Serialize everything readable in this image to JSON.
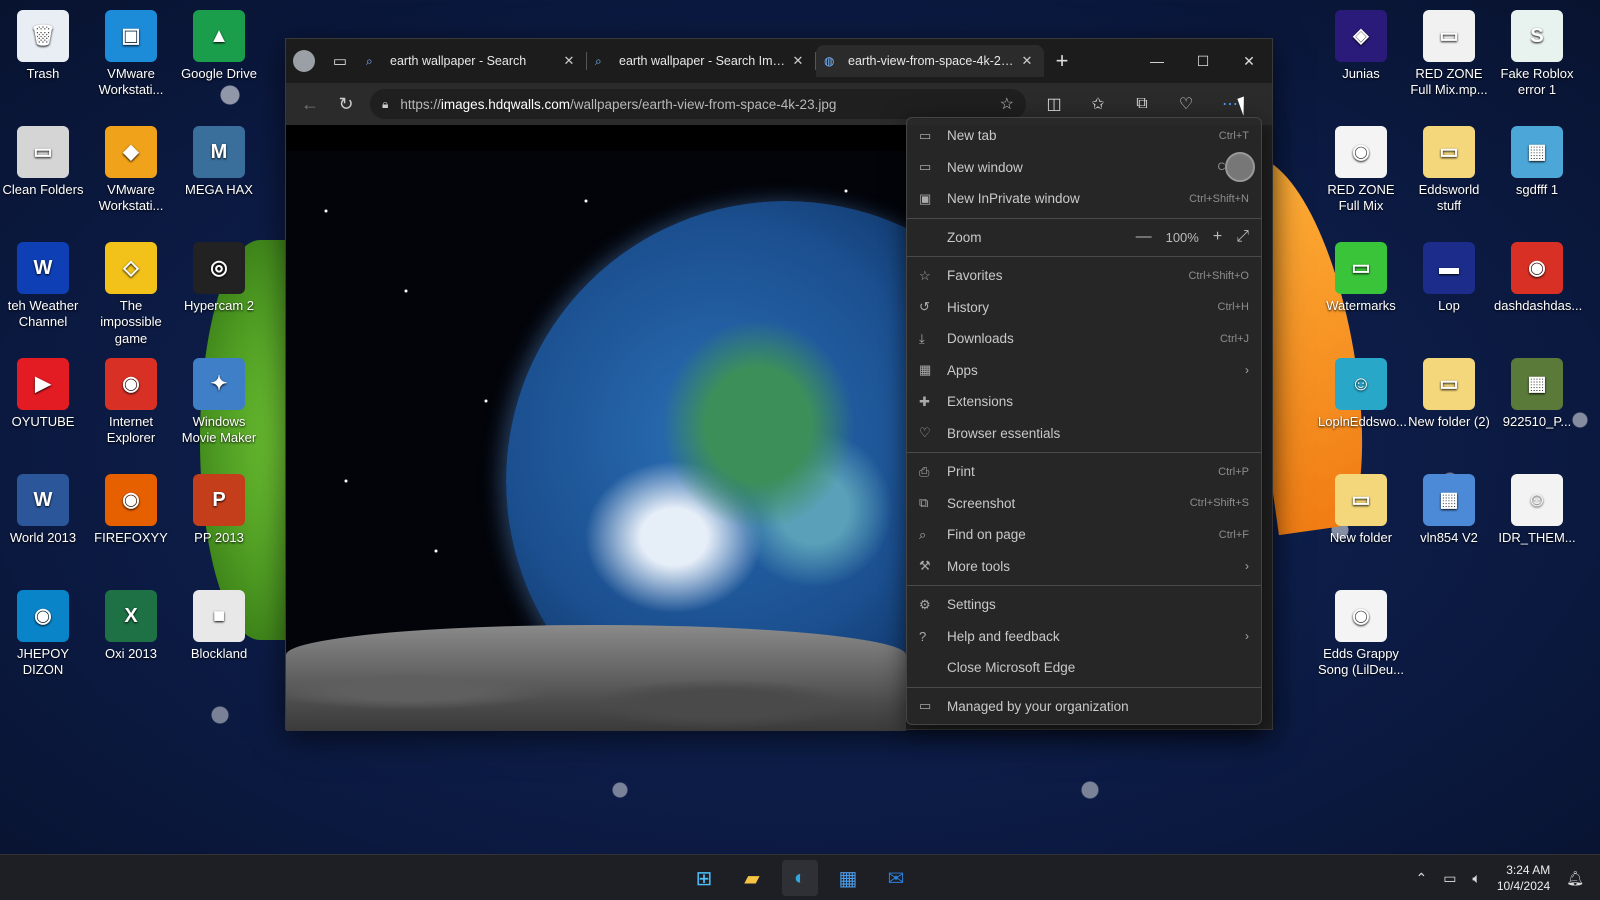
{
  "desktop": {
    "icons_left": [
      {
        "label": "Trash",
        "glyph": "🗑",
        "bg": "#e9eef5"
      },
      {
        "label": "VMware Workstati...",
        "glyph": "▣",
        "bg": "#1c8bd8"
      },
      {
        "label": "Google Drive",
        "glyph": "▲",
        "bg": "#1a9e4c"
      },
      {
        "label": "Clean Folders",
        "glyph": "▭",
        "bg": "#d5d5d5"
      },
      {
        "label": "VMware Workstati...",
        "glyph": "◆",
        "bg": "#f0a21a"
      },
      {
        "label": "MEGA HAX",
        "glyph": "M",
        "bg": "#3a6f9c"
      },
      {
        "label": "teh Weather Channel",
        "glyph": "W",
        "bg": "#0f3fb4"
      },
      {
        "label": "The impossible game",
        "glyph": "◇",
        "bg": "#f2c21a"
      },
      {
        "label": "Hypercam 2",
        "glyph": "◎",
        "bg": "#222"
      },
      {
        "label": "OYUTUBE",
        "glyph": "▶",
        "bg": "#e31b23"
      },
      {
        "label": "Internet Explorer",
        "glyph": "◉",
        "bg": "#d93025"
      },
      {
        "label": "Windows Movie Maker",
        "glyph": "✦",
        "bg": "#3f7fc8"
      },
      {
        "label": "World 2013",
        "glyph": "W",
        "bg": "#2b579a"
      },
      {
        "label": "FIREFOXYY",
        "glyph": "◉",
        "bg": "#e66000"
      },
      {
        "label": "PP 2013",
        "glyph": "P",
        "bg": "#c43e1c"
      },
      {
        "label": "JHEPOY DIZON",
        "glyph": "◉",
        "bg": "#0a84c8"
      },
      {
        "label": "Oxi 2013",
        "glyph": "X",
        "bg": "#1e7145"
      },
      {
        "label": "Blockland",
        "glyph": "■",
        "bg": "#e8e8e8"
      }
    ],
    "icons_right": [
      {
        "label": "Junias",
        "glyph": "◈",
        "bg": "#2a1b7a"
      },
      {
        "label": "RED ZONE Full Mix.mp...",
        "glyph": "▭",
        "bg": "#f1f1f1"
      },
      {
        "label": "Fake Roblox error 1",
        "glyph": "S",
        "bg": "#e8f2ef"
      },
      {
        "label": "RED ZONE Full Mix",
        "glyph": "◉",
        "bg": "#f4f4f4"
      },
      {
        "label": "Eddsworld stuff",
        "glyph": "▭",
        "bg": "#f4d77a"
      },
      {
        "label": "sgdfff 1",
        "glyph": "▦",
        "bg": "#4ca6d8"
      },
      {
        "label": "Watermarks",
        "glyph": "▭",
        "bg": "#3ac43a"
      },
      {
        "label": "Lop",
        "glyph": "▬",
        "bg": "#1b2c8a"
      },
      {
        "label": "dashdashdas...",
        "glyph": "◉",
        "bg": "#d93025"
      },
      {
        "label": "LoplnEddswo...",
        "glyph": "☺",
        "bg": "#28a7c9"
      },
      {
        "label": "New folder (2)",
        "glyph": "▭",
        "bg": "#f4d77a"
      },
      {
        "label": "922510_P...",
        "glyph": "▦",
        "bg": "#5a7a3a"
      },
      {
        "label": "New folder",
        "glyph": "▭",
        "bg": "#f4d77a"
      },
      {
        "label": "vln854 V2",
        "glyph": "▦",
        "bg": "#4c8ad8"
      },
      {
        "label": "IDR_THEM...",
        "glyph": "☺",
        "bg": "#f3f3f3"
      },
      {
        "label": "Edds Grappy Song (LilDeu...",
        "glyph": "◉",
        "bg": "#f4f4f4"
      }
    ]
  },
  "browser": {
    "tabs": [
      {
        "title": "earth wallpaper - Search",
        "icon": "search-icon",
        "active": false
      },
      {
        "title": "earth wallpaper - Search Images",
        "icon": "search-icon",
        "active": false
      },
      {
        "title": "earth-view-from-space-4k-23.jpg",
        "icon": "globe-icon",
        "active": true
      }
    ],
    "url_scheme": "https://",
    "url_host": "images.hdqwalls.com",
    "url_path": "/wallpapers/earth-view-from-space-4k-23.jpg"
  },
  "menu": {
    "items": [
      {
        "label": "New tab",
        "shortcut": "Ctrl+T",
        "icon": "new-tab-icon",
        "arrow": false
      },
      {
        "label": "New window",
        "shortcut": "Ctrl+N",
        "icon": "new-window-icon",
        "arrow": false
      },
      {
        "label": "New InPrivate window",
        "shortcut": "Ctrl+Shift+N",
        "icon": "inprivate-icon",
        "arrow": false
      },
      {
        "sep": true
      },
      {
        "label": "Zoom",
        "zoom": true,
        "zoom_value": "100%"
      },
      {
        "sep": true
      },
      {
        "label": "Favorites",
        "shortcut": "Ctrl+Shift+O",
        "icon": "star-icon",
        "arrow": false
      },
      {
        "label": "History",
        "shortcut": "Ctrl+H",
        "icon": "history-icon",
        "arrow": false
      },
      {
        "label": "Downloads",
        "shortcut": "Ctrl+J",
        "icon": "download-icon",
        "arrow": false
      },
      {
        "label": "Apps",
        "shortcut": "",
        "icon": "apps-icon",
        "arrow": true
      },
      {
        "label": "Extensions",
        "shortcut": "",
        "icon": "puzzle-icon",
        "arrow": false
      },
      {
        "label": "Browser essentials",
        "shortcut": "",
        "icon": "heart-icon",
        "arrow": false
      },
      {
        "sep": true
      },
      {
        "label": "Print",
        "shortcut": "Ctrl+P",
        "icon": "print-icon",
        "arrow": false
      },
      {
        "label": "Screenshot",
        "shortcut": "Ctrl+Shift+S",
        "icon": "screenshot-icon",
        "arrow": false
      },
      {
        "label": "Find on page",
        "shortcut": "Ctrl+F",
        "icon": "find-icon",
        "arrow": false
      },
      {
        "label": "More tools",
        "shortcut": "",
        "icon": "more-tools-icon",
        "arrow": true
      },
      {
        "sep": true
      },
      {
        "label": "Settings",
        "shortcut": "",
        "icon": "gear-icon",
        "arrow": false
      },
      {
        "label": "Help and feedback",
        "shortcut": "",
        "icon": "help-icon",
        "arrow": true
      },
      {
        "label": "Close Microsoft Edge",
        "shortcut": "",
        "icon": "",
        "arrow": false
      },
      {
        "sep": true
      },
      {
        "label": "Managed by your organization",
        "shortcut": "",
        "icon": "briefcase-icon",
        "arrow": false
      }
    ]
  },
  "taskbar": {
    "apps": [
      {
        "name": "start-button",
        "glyph": "⊞",
        "color": "#4cc2ff",
        "active": false
      },
      {
        "name": "file-explorer",
        "glyph": "▰",
        "color": "#f6c343",
        "active": false
      },
      {
        "name": "edge",
        "glyph": "◐",
        "color": "#2fa8e0",
        "active": true
      },
      {
        "name": "microsoft-store",
        "glyph": "▦",
        "color": "#4c9be8",
        "active": false
      },
      {
        "name": "outlook",
        "glyph": "✉",
        "color": "#2c7fd8",
        "active": false
      }
    ],
    "time": "3:24 AM",
    "date": "10/4/2024"
  }
}
